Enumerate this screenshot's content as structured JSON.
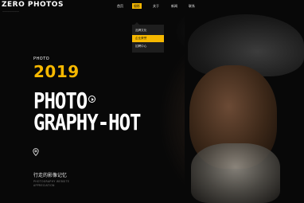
{
  "brand": {
    "logo": "ZERO PHOTOS",
    "tagline": "———————"
  },
  "nav": {
    "items": [
      {
        "label": "首页",
        "active": false
      },
      {
        "label": "摄影",
        "active": true
      },
      {
        "label": "关于",
        "active": false
      },
      {
        "label": "新闻",
        "active": false
      },
      {
        "label": "联系",
        "active": false
      }
    ]
  },
  "dropdown": {
    "items": [
      {
        "label": "品牌文化",
        "active": false
      },
      {
        "label": "企业荣誉",
        "active": true
      },
      {
        "label": "招聘中心",
        "active": false
      }
    ]
  },
  "hero": {
    "label": "PHOTO",
    "year": "2019",
    "title_line1": "PHOTO",
    "title_line2": "GRAPHY-HOT",
    "cn_title": "行走的影像记忆",
    "en_line1": "PHOTOGRAPHY WEBSITE",
    "en_line2": "APPRECIATION"
  },
  "colors": {
    "accent": "#f6b800",
    "background": "#080808",
    "text": "#ffffff"
  },
  "icons": {
    "play": "play-icon",
    "location": "location-pin-icon"
  }
}
